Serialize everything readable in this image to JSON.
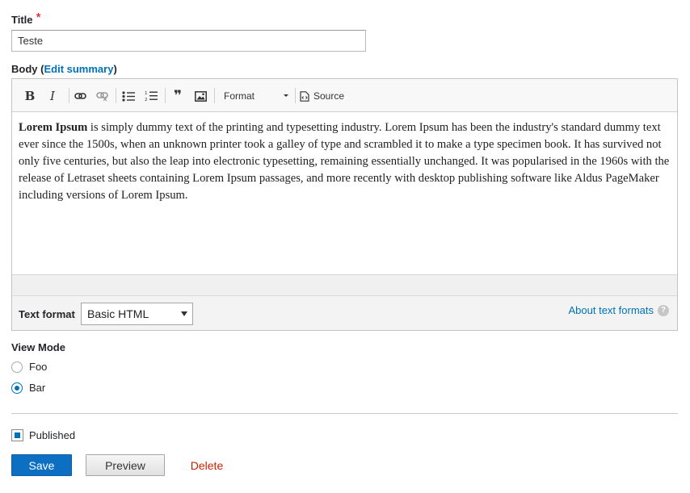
{
  "form": {
    "title_label": "Title",
    "required_marker": "*",
    "title_value": "Teste",
    "body_label": "Body",
    "body_paren_open": "(",
    "edit_summary_link": "Edit summary",
    "body_paren_close": ")"
  },
  "toolbar": {
    "buttons": [
      {
        "name": "bold",
        "icon": "bold-icon",
        "glyph": "B"
      },
      {
        "name": "italic",
        "icon": "italic-icon",
        "glyph": "I"
      },
      {
        "name": "link",
        "icon": "link-icon"
      },
      {
        "name": "unlink",
        "icon": "unlink-icon"
      },
      {
        "name": "bulleted-list",
        "icon": "bulleted-list-icon"
      },
      {
        "name": "numbered-list",
        "icon": "numbered-list-icon"
      },
      {
        "name": "blockquote",
        "icon": "blockquote-icon",
        "glyph": "❞"
      },
      {
        "name": "image",
        "icon": "image-icon"
      }
    ],
    "format_label": "Format",
    "source_label": "Source"
  },
  "editor": {
    "bold_lead": "Lorem Ipsum",
    "paragraph": " is simply dummy text of the printing and typesetting industry. Lorem Ipsum has been the industry's standard dummy text ever since the 1500s, when an unknown printer took a galley of type and scrambled it to make a type specimen book. It has survived not only five centuries, but also the leap into electronic typesetting, remaining essentially unchanged. It was popularised in the 1960s with the release of Letraset sheets containing Lorem Ipsum passages, and more recently with desktop publishing software like Aldus PageMaker including versions of Lorem Ipsum."
  },
  "text_format": {
    "label": "Text format",
    "selected": "Basic HTML",
    "about_link": "About text formats",
    "help_glyph": "?"
  },
  "view_mode": {
    "label": "View Mode",
    "options": [
      {
        "label": "Foo",
        "checked": false
      },
      {
        "label": "Bar",
        "checked": true
      }
    ]
  },
  "published": {
    "label": "Published",
    "checked": true
  },
  "actions": {
    "save": "Save",
    "preview": "Preview",
    "delete": "Delete"
  },
  "colors": {
    "accent": "#0071b8",
    "save_button": "#0c6fc2",
    "delete_link": "#c72100",
    "required": "#ee0000"
  }
}
